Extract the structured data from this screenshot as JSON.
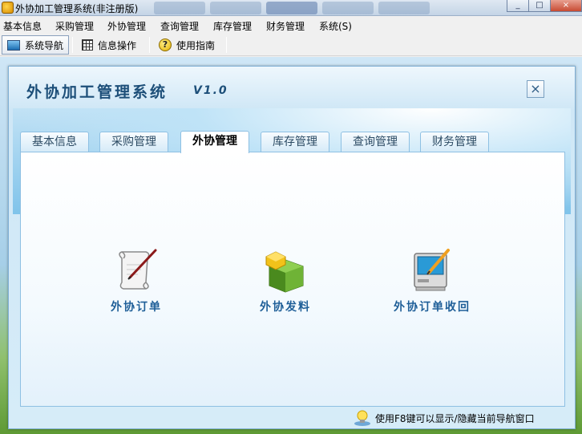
{
  "window": {
    "title": "外协加工管理系统(非注册版)",
    "controls": [
      "_",
      "□",
      "×"
    ]
  },
  "menu": {
    "items": [
      "基本信息",
      "采购管理",
      "外协管理",
      "查询管理",
      "库存管理",
      "财务管理",
      "系统(S)"
    ]
  },
  "toolbar": {
    "buttons": [
      {
        "label": "系统导航",
        "icon": "navigator-icon"
      },
      {
        "label": "信息操作",
        "icon": "grid-icon"
      },
      {
        "label": "使用指南",
        "icon": "help-icon"
      }
    ]
  },
  "panel": {
    "title": "外协加工管理系统",
    "version": "V1.0",
    "close": "×",
    "tabs": [
      "基本信息",
      "采购管理",
      "外协管理",
      "库存管理",
      "查询管理",
      "财务管理"
    ],
    "active_tab": "外协管理",
    "features": [
      {
        "label": "外协订单",
        "icon": "scroll-quill-icon"
      },
      {
        "label": "外协发料",
        "icon": "material-blocks-icon"
      },
      {
        "label": "外协订单收回",
        "icon": "computer-pencil-icon"
      }
    ],
    "footer_hint": "使用F8键可以显示/隐藏当前导航窗口"
  }
}
